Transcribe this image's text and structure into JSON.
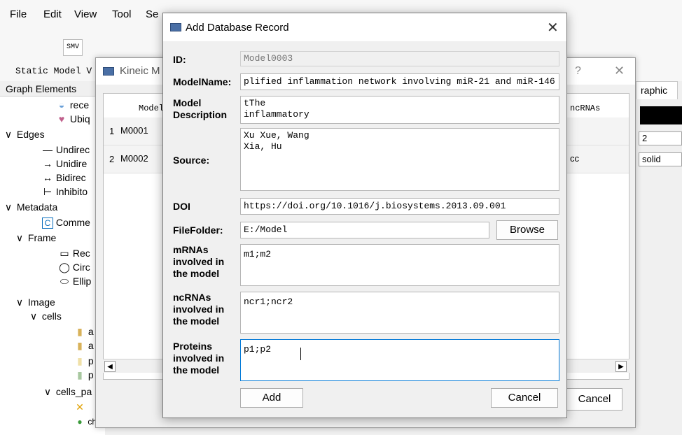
{
  "menu": {
    "file": "File",
    "edit": "Edit",
    "view": "View",
    "tool": "Tool",
    "search": "Se"
  },
  "toolbar": {
    "smv": "SMV",
    "static_label": "Static Model V"
  },
  "graph_elements": {
    "header": "Graph Elements",
    "rows": [
      {
        "text": "rece",
        "icon": "receptor-icon"
      },
      {
        "text": "Ubiq",
        "icon": "ubiquitin-icon"
      },
      {
        "text": "Edges",
        "arrow": "∨"
      },
      {
        "text": "Undirec",
        "icon": "undirected-line-icon"
      },
      {
        "text": "Unidire",
        "icon": "unidirected-arrow-icon"
      },
      {
        "text": "Bidirec",
        "icon": "bidirected-arrow-icon"
      },
      {
        "text": "Inhibito",
        "icon": "inhibitor-line-icon"
      },
      {
        "text": "Metadata",
        "arrow": "∨"
      },
      {
        "text": "Comme",
        "icon": "comment-icon"
      },
      {
        "text": "Frame",
        "arrow": "∨"
      },
      {
        "text": "Rec",
        "icon": "rectangle-icon"
      },
      {
        "text": "Circ",
        "icon": "circle-icon"
      },
      {
        "text": "Ellip",
        "icon": "ellipse-icon"
      },
      {
        "text": "Image",
        "arrow": "∨"
      },
      {
        "text": "cells",
        "arrow": "∨"
      },
      {
        "text": "a",
        "icon": "image-file-icon"
      },
      {
        "text": "a",
        "icon": "image-file-icon"
      },
      {
        "text": "p",
        "icon": "image-file-icon"
      },
      {
        "text": "p",
        "icon": "image-file-icon"
      },
      {
        "text": "cells_pa",
        "arrow": "∨"
      },
      {
        "text": "",
        "icon": "pathway-icon"
      },
      {
        "text": "chloroplast",
        "icon": "chloroplast-icon"
      }
    ]
  },
  "right_panel": {
    "tab": "raphic",
    "width_value": "2",
    "style_value": "solid"
  },
  "kineic": {
    "title": "Kineic M",
    "help": "?",
    "col_model": "Model",
    "col_ncrnas": "ncRNAs",
    "rows": [
      {
        "num": "1",
        "id": "M0001",
        "ncrnas": ""
      },
      {
        "num": "2",
        "id": "M0002",
        "ncrnas": "cc"
      }
    ],
    "cancel": "Cancel"
  },
  "dialog": {
    "title": "Add Database Record",
    "labels": {
      "id": "ID:",
      "model_name": "ModelName:",
      "model_description_1": "Model",
      "model_description_2": "Description",
      "source": "Source:",
      "doi": "DOI",
      "file_folder": "FileFolder:",
      "mrnas_1": "mRNAs",
      "mrnas_2": "involved in",
      "mrnas_3": "the model",
      "ncrnas_1": "ncRNAs",
      "ncrnas_2": "involved in",
      "ncrnas_3": "the model",
      "proteins_1": "Proteins",
      "proteins_2": "involved in",
      "proteins_3": "the model"
    },
    "values": {
      "id": "Model0003",
      "model_name": "plified inflammation network involving miR-21 and miR-146",
      "model_description": "tThe\ninflammatory",
      "source": "Xu Xue, Wang\nXia, Hu",
      "doi": "https://doi.org/10.1016/j.biosystems.2013.09.001",
      "file_folder": "E:/Model",
      "mrnas": "m1;m2",
      "ncrnas": "ncr1;ncr2",
      "proteins": "p1;p2"
    },
    "buttons": {
      "browse": "Browse",
      "add": "Add",
      "cancel": "Cancel"
    }
  }
}
